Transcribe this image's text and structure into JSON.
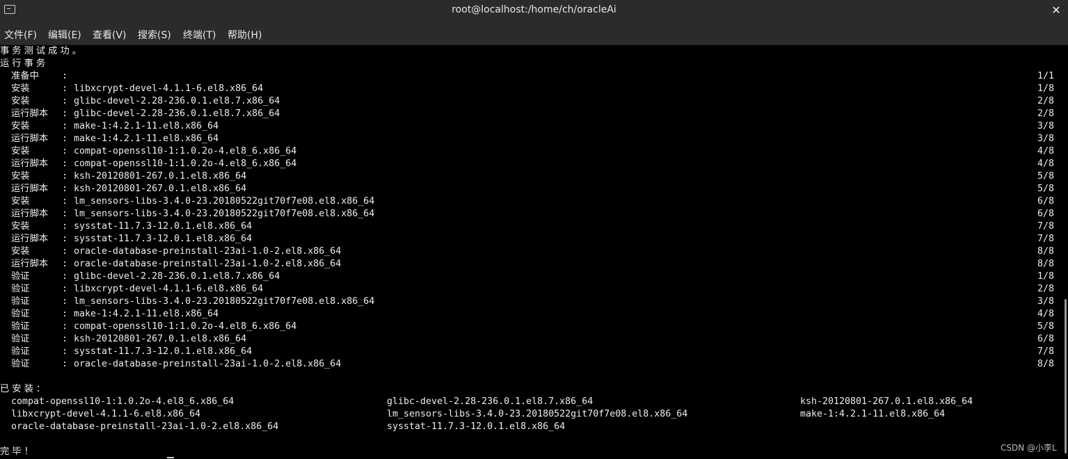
{
  "window": {
    "title": "root@localhost:/home/ch/oracleAi"
  },
  "menu": [
    "文件(F)",
    "编辑(E)",
    "查看(V)",
    "搜索(S)",
    "终端(T)",
    "帮助(H)"
  ],
  "terminal": {
    "line1": "事务测试成功。",
    "line2": "运行事务",
    "transaction": [
      {
        "action": "准备中",
        "package": "",
        "count": "1/1"
      },
      {
        "action": "安装",
        "package": "libxcrypt-devel-4.1.1-6.el8.x86_64",
        "count": "1/8"
      },
      {
        "action": "安装",
        "package": "glibc-devel-2.28-236.0.1.el8.7.x86_64",
        "count": "2/8"
      },
      {
        "action": "运行脚本",
        "package": "glibc-devel-2.28-236.0.1.el8.7.x86_64",
        "count": "2/8"
      },
      {
        "action": "安装",
        "package": "make-1:4.2.1-11.el8.x86_64",
        "count": "3/8"
      },
      {
        "action": "运行脚本",
        "package": "make-1:4.2.1-11.el8.x86_64",
        "count": "3/8"
      },
      {
        "action": "安装",
        "package": "compat-openssl10-1:1.0.2o-4.el8_6.x86_64",
        "count": "4/8"
      },
      {
        "action": "运行脚本",
        "package": "compat-openssl10-1:1.0.2o-4.el8_6.x86_64",
        "count": "4/8"
      },
      {
        "action": "安装",
        "package": "ksh-20120801-267.0.1.el8.x86_64",
        "count": "5/8"
      },
      {
        "action": "运行脚本",
        "package": "ksh-20120801-267.0.1.el8.x86_64",
        "count": "5/8"
      },
      {
        "action": "安装",
        "package": "lm_sensors-libs-3.4.0-23.20180522git70f7e08.el8.x86_64",
        "count": "6/8"
      },
      {
        "action": "运行脚本",
        "package": "lm_sensors-libs-3.4.0-23.20180522git70f7e08.el8.x86_64",
        "count": "6/8"
      },
      {
        "action": "安装",
        "package": "sysstat-11.7.3-12.0.1.el8.x86_64",
        "count": "7/8"
      },
      {
        "action": "运行脚本",
        "package": "sysstat-11.7.3-12.0.1.el8.x86_64",
        "count": "7/8"
      },
      {
        "action": "安装",
        "package": "oracle-database-preinstall-23ai-1.0-2.el8.x86_64",
        "count": "8/8"
      },
      {
        "action": "运行脚本",
        "package": "oracle-database-preinstall-23ai-1.0-2.el8.x86_64",
        "count": "8/8"
      },
      {
        "action": "验证",
        "package": "glibc-devel-2.28-236.0.1.el8.7.x86_64",
        "count": "1/8"
      },
      {
        "action": "验证",
        "package": "libxcrypt-devel-4.1.1-6.el8.x86_64",
        "count": "2/8"
      },
      {
        "action": "验证",
        "package": "lm_sensors-libs-3.4.0-23.20180522git70f7e08.el8.x86_64",
        "count": "3/8"
      },
      {
        "action": "验证",
        "package": "make-1:4.2.1-11.el8.x86_64",
        "count": "4/8"
      },
      {
        "action": "验证",
        "package": "compat-openssl10-1:1.0.2o-4.el8_6.x86_64",
        "count": "5/8"
      },
      {
        "action": "验证",
        "package": "ksh-20120801-267.0.1.el8.x86_64",
        "count": "6/8"
      },
      {
        "action": "验证",
        "package": "sysstat-11.7.3-12.0.1.el8.x86_64",
        "count": "7/8"
      },
      {
        "action": "验证",
        "package": "oracle-database-preinstall-23ai-1.0-2.el8.x86_64",
        "count": "8/8"
      }
    ],
    "separator": ":",
    "installed_header": "已安装：",
    "installed": [
      [
        "compat-openssl10-1:1.0.2o-4.el8_6.x86_64",
        "glibc-devel-2.28-236.0.1.el8.7.x86_64",
        "ksh-20120801-267.0.1.el8.x86_64"
      ],
      [
        "libxcrypt-devel-4.1.1-6.el8.x86_64",
        "lm_sensors-libs-3.4.0-23.20180522git70f7e08.el8.x86_64",
        "make-1:4.2.1-11.el8.x86_64"
      ],
      [
        "oracle-database-preinstall-23ai-1.0-2.el8.x86_64",
        "sysstat-11.7.3-12.0.1.el8.x86_64",
        ""
      ]
    ],
    "done": "完毕！"
  },
  "watermark": "CSDN @小李L"
}
